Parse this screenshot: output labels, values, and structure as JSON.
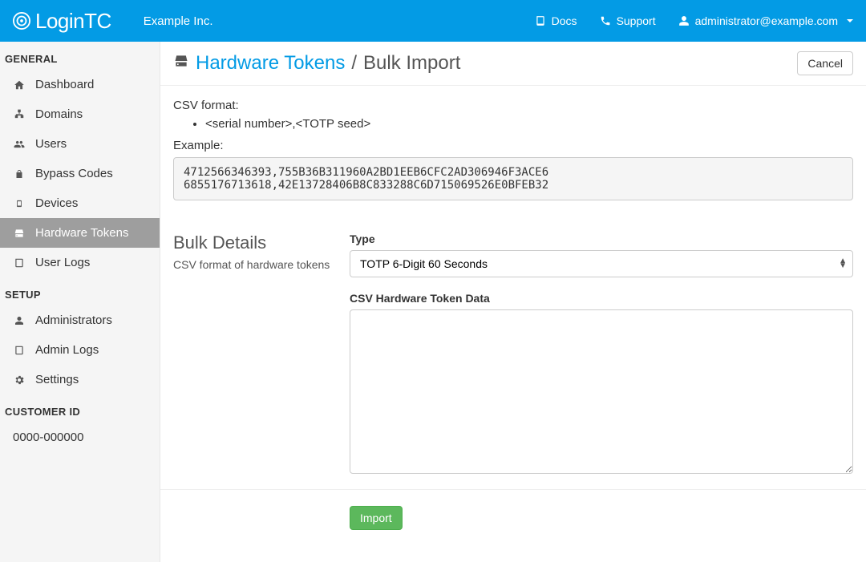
{
  "brand": {
    "name": "LoginTC",
    "company": "Example Inc."
  },
  "topnav": {
    "docs": "Docs",
    "support": "Support",
    "user": "administrator@example.com"
  },
  "sidebar": {
    "sections": {
      "general": {
        "title": "GENERAL",
        "items": [
          {
            "label": "Dashboard"
          },
          {
            "label": "Domains"
          },
          {
            "label": "Users"
          },
          {
            "label": "Bypass Codes"
          },
          {
            "label": "Devices"
          },
          {
            "label": "Hardware Tokens"
          },
          {
            "label": "User Logs"
          }
        ]
      },
      "setup": {
        "title": "SETUP",
        "items": [
          {
            "label": "Administrators"
          },
          {
            "label": "Admin Logs"
          },
          {
            "label": "Settings"
          }
        ]
      },
      "customer": {
        "title": "CUSTOMER ID",
        "id": "0000-000000"
      }
    }
  },
  "page": {
    "breadcrumb": {
      "link": "Hardware Tokens",
      "current": "Bulk Import",
      "sep": "/"
    },
    "cancel": "Cancel",
    "csv_format_label": "CSV format:",
    "csv_format_item": "<serial number>,<TOTP seed>",
    "example_label": "Example:",
    "example_text": "4712566346393,755B36B311960A2BD1EEB6CFC2AD306946F3ACE6\n6855176713618,42E13728406B8C833288C6D715069526E0BFEB32"
  },
  "form": {
    "heading": "Bulk Details",
    "subtext": "CSV format of hardware tokens",
    "type_label": "Type",
    "type_selected": "TOTP 6-Digit 60 Seconds",
    "csv_data_label": "CSV Hardware Token Data",
    "csv_data_value": "",
    "import_btn": "Import"
  }
}
